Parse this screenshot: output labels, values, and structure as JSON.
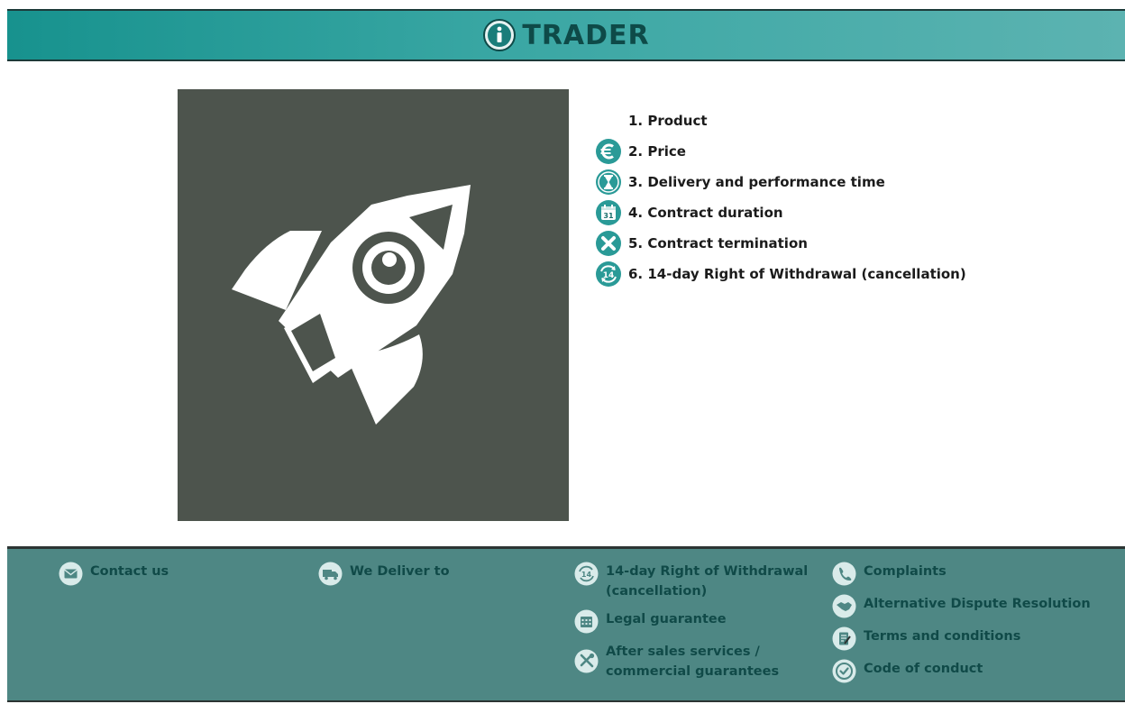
{
  "header": {
    "title": "TRADER",
    "icon": "info-circle-icon",
    "colors": {
      "bar": "#3aa7a4",
      "title": "#0e4a48"
    }
  },
  "hero": {
    "icon": "rocket-icon",
    "background": "#4d544d"
  },
  "info_list": [
    {
      "label": "1. Product",
      "icon": "none"
    },
    {
      "label": "2. Price",
      "icon": "euro-icon"
    },
    {
      "label": "3. Delivery and performance  time",
      "icon": "hourglass-icon"
    },
    {
      "label": "4. Contract duration",
      "icon": "calendar-icon"
    },
    {
      "label": "5. Contract termination",
      "icon": "close-circle-icon"
    },
    {
      "label": "6. 14-day Right of Withdrawal (cancellation)",
      "icon": "withdrawal-14-icon"
    }
  ],
  "footer": {
    "background": "#4e8784",
    "col1": {
      "contact": {
        "label": "Contact us",
        "icon": "envelope-icon"
      }
    },
    "col2": {
      "deliver": {
        "label": "We Deliver to",
        "icon": "truck-icon"
      }
    },
    "col3": {
      "withdrawal": {
        "line1": "14-day Right of Withdrawal",
        "line2": "(cancellation)",
        "icon": "withdrawal-14-icon"
      },
      "guarantee": {
        "label": "Legal guarantee",
        "icon": "calendar-grid-icon"
      },
      "aftersales": {
        "line1": "After sales services /",
        "line2": "commercial guarantees",
        "icon": "tools-icon"
      }
    },
    "col4": {
      "complaints": {
        "label": "Complaints",
        "icon": "complaint-icon"
      },
      "adr": {
        "label": "Alternative Dispute Resolution",
        "icon": "handshake-icon"
      },
      "terms": {
        "label": "Terms and conditions",
        "icon": "document-pen-icon"
      },
      "conduct": {
        "label": "Code of conduct",
        "icon": "check-circle-icon"
      }
    }
  }
}
